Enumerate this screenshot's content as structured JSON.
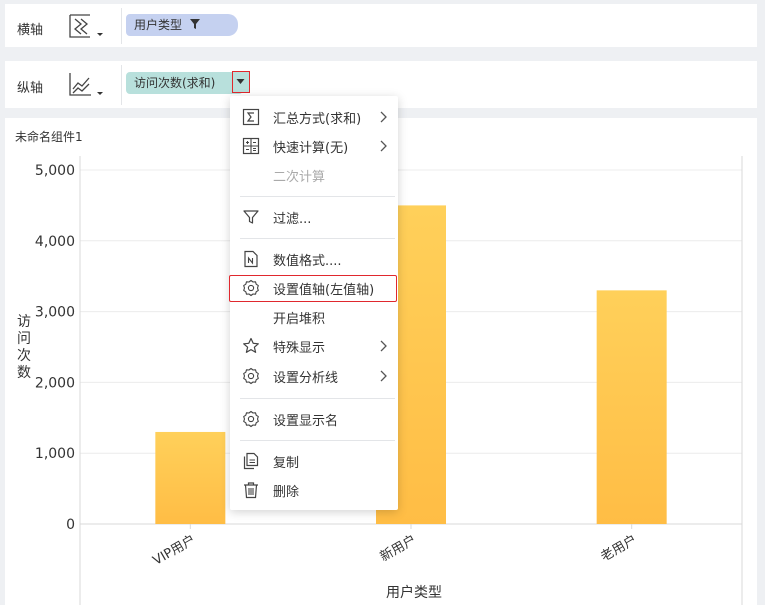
{
  "x_axis_row": {
    "label": "横轴",
    "chart_icon": "waterfall-chart-icon",
    "field": "用户类型",
    "field_icon": "filter-icon"
  },
  "y_axis_row": {
    "label": "纵轴",
    "chart_icon": "line-chart-icon",
    "field": "访问次数(求和)",
    "field_icon": "dropdown-arrow-icon"
  },
  "component_title": "未命名组件1",
  "chart_data": {
    "type": "bar",
    "categories": [
      "VIP用户",
      "新用户",
      "老用户"
    ],
    "values": [
      1300,
      4500,
      3300
    ],
    "xlabel": "用户类型",
    "ylabel": "访问次数",
    "y_ticks": [
      "0",
      "1,000",
      "2,000",
      "3,000",
      "4,000",
      "5,000"
    ],
    "ylim": [
      0,
      5000
    ],
    "grid": true,
    "bar_color_top": "#ffd05a",
    "bar_color_bottom": "#ffbd45"
  },
  "context_menu": {
    "items": [
      {
        "label": "汇总方式(求和)",
        "icon": "sum-icon",
        "submenu": true
      },
      {
        "label": "快速计算(无)",
        "icon": "calculator-icon",
        "submenu": true
      },
      {
        "label": "二次计算",
        "icon": "",
        "disabled": true
      },
      {
        "label": "过滤...",
        "icon": "filter-icon"
      },
      {
        "label": "数值格式....",
        "icon": "number-format-icon"
      },
      {
        "label": "设置值轴(左值轴)",
        "icon": "gear-icon",
        "highlighted": true
      },
      {
        "label": "开启堆积",
        "icon": ""
      },
      {
        "label": "特殊显示",
        "icon": "star-icon",
        "submenu": true
      },
      {
        "label": "设置分析线",
        "icon": "gear-icon",
        "submenu": true
      },
      {
        "label": "设置显示名",
        "icon": "gear-icon"
      },
      {
        "label": "复制",
        "icon": "copy-icon"
      },
      {
        "label": "删除",
        "icon": "trash-icon"
      }
    ]
  },
  "colors": {
    "highlight_red": "#e0282e",
    "x_pill": "#c5d1f0",
    "y_pill": "#b8e0dc"
  }
}
